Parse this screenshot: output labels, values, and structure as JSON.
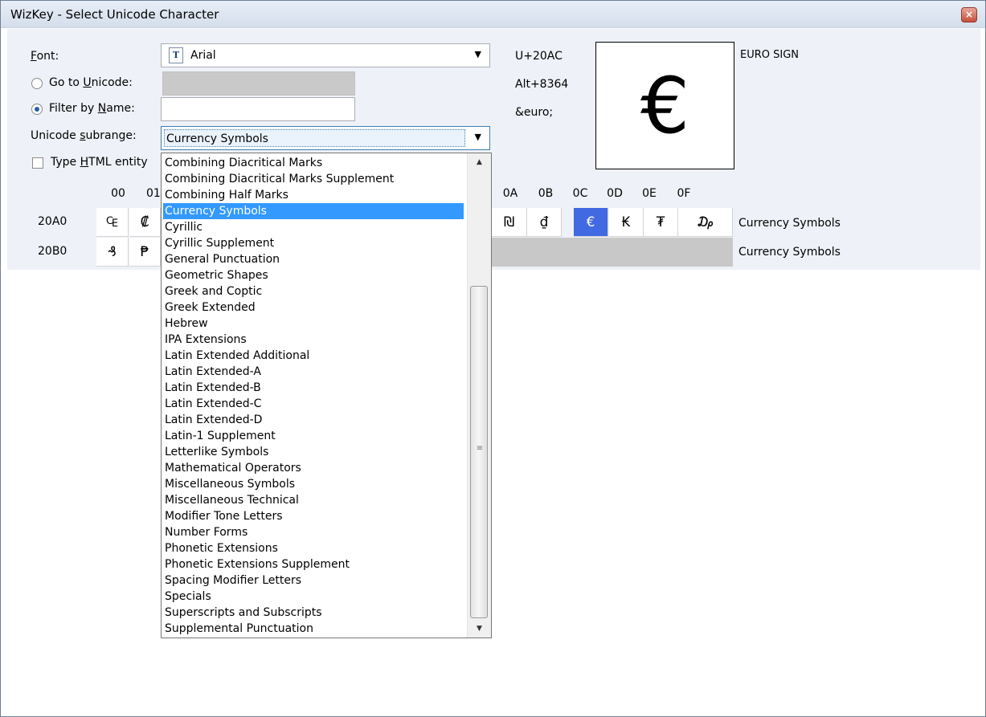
{
  "window": {
    "title": "WizKey - Select Unicode Character",
    "close_label": "×"
  },
  "controls": {
    "font_label": "Font:",
    "font_accel": "F",
    "font_label_rest": "ont:",
    "font_value": "Arial",
    "font_icon_glyph": "T",
    "goto_unicode_label_pre": "Go to ",
    "goto_unicode_accel": "U",
    "goto_unicode_label_post": "nicode:",
    "goto_unicode_value": "",
    "filter_name_label_pre": "Filter by ",
    "filter_name_accel": "N",
    "filter_name_label_post": "ame:",
    "filter_name_value": "",
    "subrange_label_pre": "Unicode ",
    "subrange_accel": "s",
    "subrange_label_post": "ubrange:",
    "subrange_value": "Currency Symbols",
    "html_entity_label_pre": "Type ",
    "html_entity_accel": "H",
    "html_entity_label_post": "TML entity",
    "goto_unicode_selected": false,
    "filter_name_selected": true,
    "html_entity_checked": false
  },
  "character_info": {
    "codepoint": "U+20AC",
    "alt_code": "Alt+8364",
    "html_entity": "&euro;",
    "name": "EURO SIGN",
    "preview_glyph": "€"
  },
  "grid": {
    "column_headers": [
      "00",
      "01",
      "0A",
      "0B",
      "0C",
      "0D",
      "0E",
      "0F"
    ],
    "rows": [
      {
        "code": "20A0",
        "cells": [
          "₠",
          "₡",
          "₪",
          "₫",
          "€",
          "₭",
          "₮",
          "₯"
        ],
        "selected_glyph": "€",
        "subrange": "Currency Symbols"
      },
      {
        "code": "20B0",
        "cells": [
          "₰",
          "₱"
        ],
        "subrange": "Currency Symbols"
      }
    ]
  },
  "dropdown": {
    "items": [
      "Combining Diacritical Marks",
      "Combining Diacritical Marks Supplement",
      "Combining Half Marks",
      "Currency Symbols",
      "Cyrillic",
      "Cyrillic Supplement",
      "General Punctuation",
      "Geometric Shapes",
      "Greek and Coptic",
      "Greek Extended",
      "Hebrew",
      "IPA Extensions",
      "Latin Extended Additional",
      "Latin Extended-A",
      "Latin Extended-B",
      "Latin Extended-C",
      "Latin Extended-D",
      "Latin-1 Supplement",
      "Letterlike Symbols",
      "Mathematical Operators",
      "Miscellaneous Symbols",
      "Miscellaneous Technical",
      "Modifier Tone Letters",
      "Number Forms",
      "Phonetic Extensions",
      "Phonetic Extensions Supplement",
      "Spacing Modifier Letters",
      "Specials",
      "Superscripts and Subscripts",
      "Supplemental Punctuation"
    ],
    "selected_item": "Currency Symbols"
  },
  "colors": {
    "selection": "#4169e1",
    "dropdown_highlight": "#3399ff",
    "panel_bg": "#eef1f7"
  }
}
